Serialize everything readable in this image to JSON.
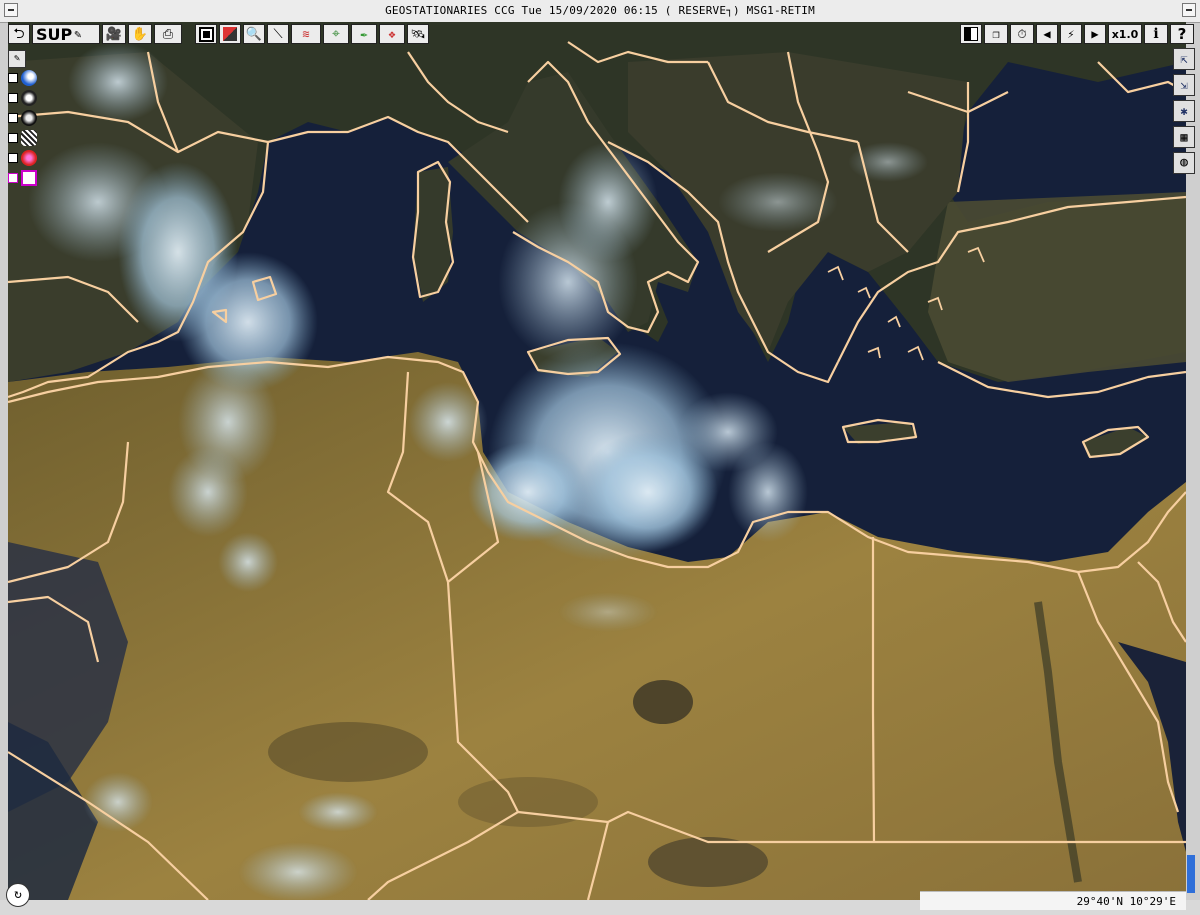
{
  "window": {
    "title": "GEOSTATIONARIES CCG Tue 15/09/2020 06:15 (    RESERVE┐) MSG1-RETIM"
  },
  "toolbar": {
    "back_icon": "undo-arrow-icon",
    "sup_label": "SUP",
    "eraser_icon": "eraser-icon",
    "camera_icon": "camera-icon",
    "hand_icon": "hand-icon",
    "print_icon": "printer-icon",
    "tools_left": [
      "square-select-icon",
      "palette-icon",
      "zoom-magnifier-icon",
      "line-draw-icon",
      "wind-barbs-icon",
      "crosshair-target-icon",
      "pen-icon",
      "map-layers-icon",
      "satellite-icon"
    ],
    "tools_right": [
      "brightness-icon",
      "overlay-icon",
      "timer-icon",
      "step-back-icon",
      "animation-icon",
      "step-forward-icon"
    ],
    "zoom_label": "x1.0",
    "info_icon": "info-icon",
    "help_label": "?"
  },
  "layers": [
    {
      "name": "layer-1",
      "icon": "satellite-blue-icon"
    },
    {
      "name": "layer-2",
      "icon": "radar-icon"
    },
    {
      "name": "layer-3",
      "icon": "lightning-icon"
    },
    {
      "name": "layer-4",
      "icon": "cloud-hatch-icon"
    },
    {
      "name": "layer-5",
      "icon": "sun-red-icon"
    },
    {
      "name": "layer-6",
      "icon": "frame-magenta-icon"
    }
  ],
  "right_panel": [
    "export-icon",
    "export-down-icon",
    "figure-icon",
    "grid-icon",
    "globe-icon"
  ],
  "status": {
    "coordinates": "29°40'N 10°29'E"
  },
  "colors": {
    "sea": "#15203a",
    "land": "#7d6a35",
    "desert": "#a88c48",
    "cloud": "#cfe6f5",
    "border": "#f7cfa0",
    "accent": "#2f6fd9"
  }
}
